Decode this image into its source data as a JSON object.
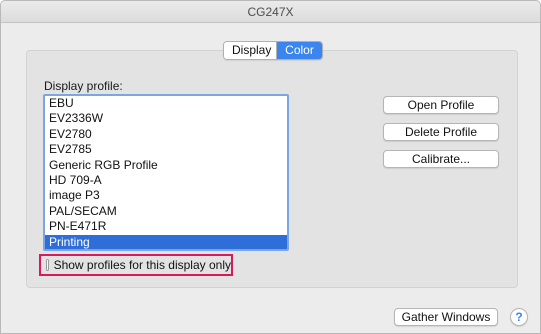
{
  "window": {
    "title": "CG247X"
  },
  "tabs": [
    {
      "label": "Display",
      "selected": false
    },
    {
      "label": "Color",
      "selected": true
    }
  ],
  "profile_section": {
    "label": "Display profile:"
  },
  "profiles": [
    "EBU",
    "EV2336W",
    "EV2780",
    "EV2785",
    "Generic RGB Profile",
    "HD 709-A",
    "image P3",
    "PAL/SECAM",
    "PN-E471R",
    "Printing"
  ],
  "selected_profile": "Printing",
  "buttons": {
    "open_profile": "Open Profile",
    "delete_profile": "Delete Profile",
    "calibrate": "Calibrate...",
    "gather_windows": "Gather Windows",
    "help": "?"
  },
  "checkbox": {
    "label": "Show profiles for this display only",
    "checked": false
  },
  "colors": {
    "accent": "#3b86ee",
    "selection": "#2f6ed9",
    "highlight_box": "#d8195d"
  }
}
